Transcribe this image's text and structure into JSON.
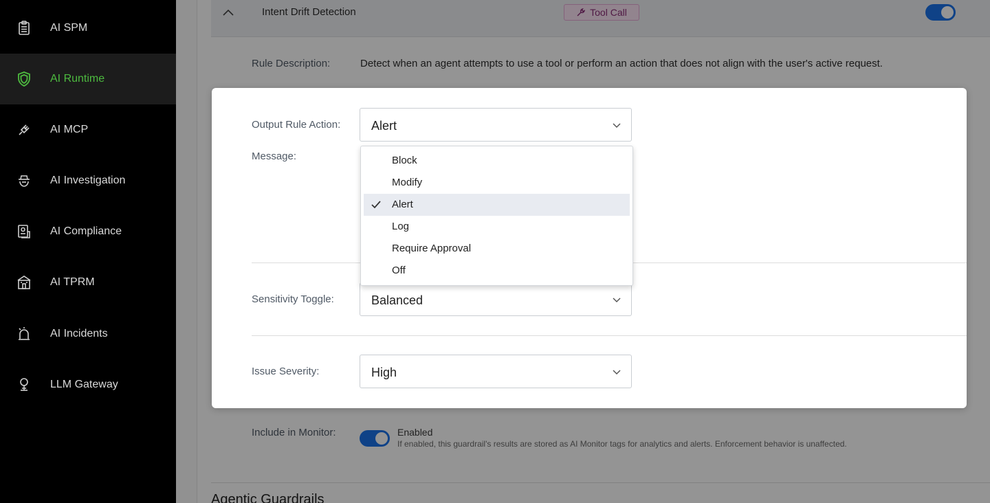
{
  "sidebar": {
    "items": [
      {
        "label": "AI SPM",
        "icon": "clipboard-icon"
      },
      {
        "label": "AI Runtime",
        "icon": "shield-icon"
      },
      {
        "label": "AI MCP",
        "icon": "plug-icon"
      },
      {
        "label": "AI Investigation",
        "icon": "detective-icon"
      },
      {
        "label": "AI Compliance",
        "icon": "compliance-icon"
      },
      {
        "label": "AI TPRM",
        "icon": "building-icon"
      },
      {
        "label": "AI Incidents",
        "icon": "alarm-icon"
      },
      {
        "label": "LLM Gateway",
        "icon": "gateway-icon"
      }
    ],
    "active_color": "#4dbb3f"
  },
  "rule": {
    "title": "Intent Drift Detection",
    "badge": "Tool Call",
    "enabled": true,
    "description_label": "Rule Description:",
    "description": "Detect when an agent attempts to use a tool or perform an action that does not align with the user's active request."
  },
  "modal": {
    "output_rule_action_label": "Output Rule Action:",
    "output_rule_action_value": "Alert",
    "message_label": "Message:",
    "sensitivity_label": "Sensitivity Toggle:",
    "sensitivity_value": "Balanced",
    "severity_label": "Issue Severity:",
    "severity_value": "High"
  },
  "dropdown": {
    "options": [
      "Block",
      "Modify",
      "Alert",
      "Log",
      "Require Approval",
      "Off"
    ],
    "selected": "Alert"
  },
  "monitor": {
    "label": "Include in Monitor:",
    "status": "Enabled",
    "help": "If enabled, this guardrail's results are stored as AI Monitor tags for analytics and alerts. Enforcement behavior is unaffected."
  },
  "section": {
    "title": "Agentic Guardrails"
  }
}
